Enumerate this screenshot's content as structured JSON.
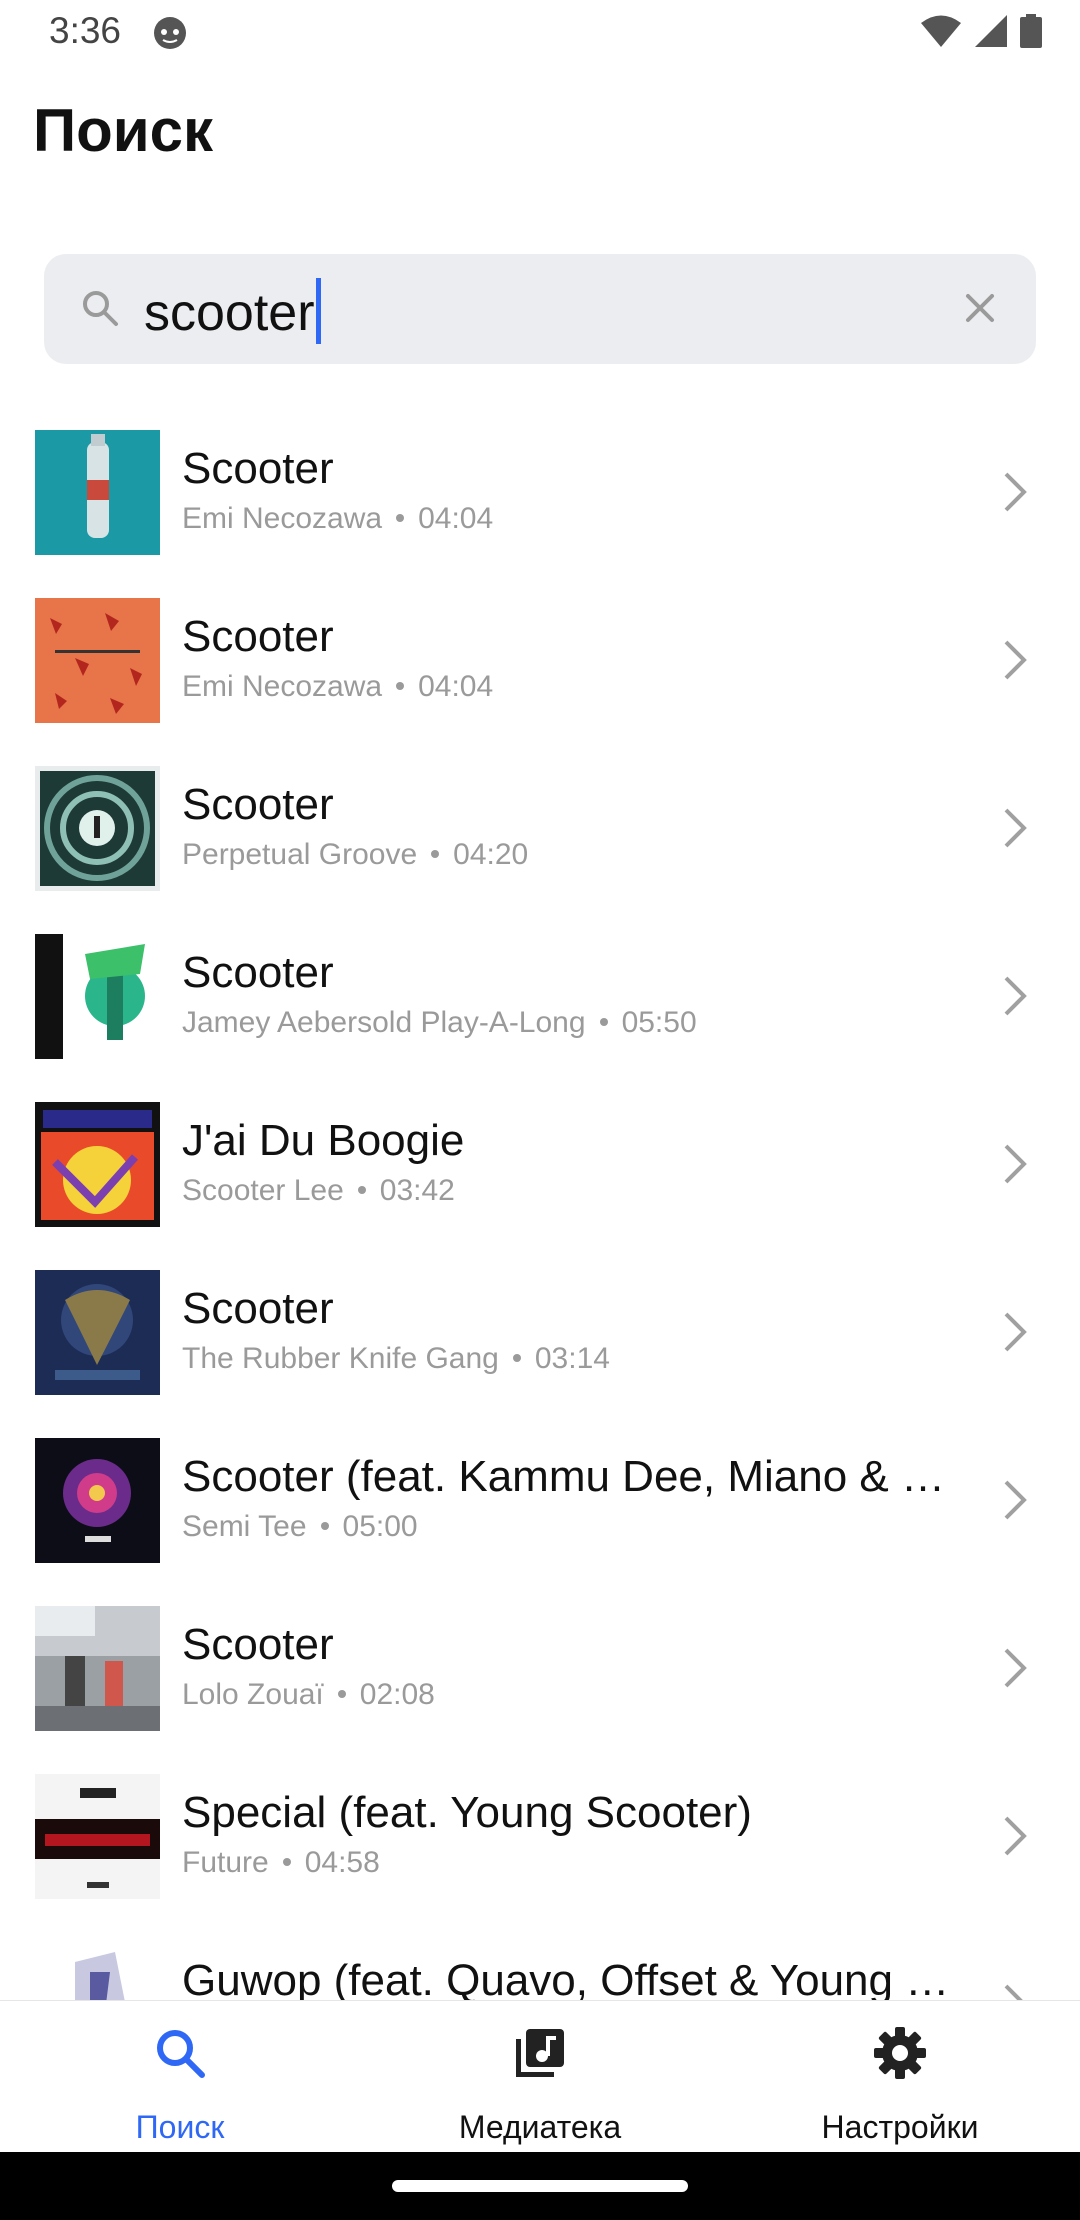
{
  "status_bar": {
    "time": "3:36"
  },
  "page": {
    "title": "Поиск"
  },
  "search": {
    "value": "scooter"
  },
  "results": [
    {
      "title": "Scooter",
      "artist": "Emi Necozawa",
      "duration": "04:04"
    },
    {
      "title": "Scooter",
      "artist": "Emi Necozawa",
      "duration": "04:04"
    },
    {
      "title": "Scooter",
      "artist": "Perpetual Groove",
      "duration": "04:20"
    },
    {
      "title": "Scooter",
      "artist": "Jamey Aebersold Play-A-Long",
      "duration": "05:50"
    },
    {
      "title": "J'ai Du Boogie",
      "artist": "Scooter Lee",
      "duration": "03:42"
    },
    {
      "title": "Scooter",
      "artist": "The Rubber Knife Gang",
      "duration": "03:14"
    },
    {
      "title": "Scooter (feat. Kammu Dee, Miano & DJ Mujava)",
      "artist": "Semi Tee",
      "duration": "05:00"
    },
    {
      "title": "Scooter",
      "artist": "Lolo Zouaï",
      "duration": "02:08"
    },
    {
      "title": "Special (feat. Young Scooter)",
      "artist": "Future",
      "duration": "04:58"
    },
    {
      "title": "Guwop (feat. Quavo, Offset & Young Scooter)",
      "artist": "",
      "duration": ""
    }
  ],
  "bottom_nav": [
    {
      "label": "Поиск",
      "icon": "search-icon",
      "active": true
    },
    {
      "label": "Медиатека",
      "icon": "library-music-icon",
      "active": false
    },
    {
      "label": "Настройки",
      "icon": "gear-icon",
      "active": false
    }
  ],
  "colors": {
    "accent": "#2f68f5",
    "subtext": "#9a9a9a",
    "search_bg": "#ebedf0"
  }
}
